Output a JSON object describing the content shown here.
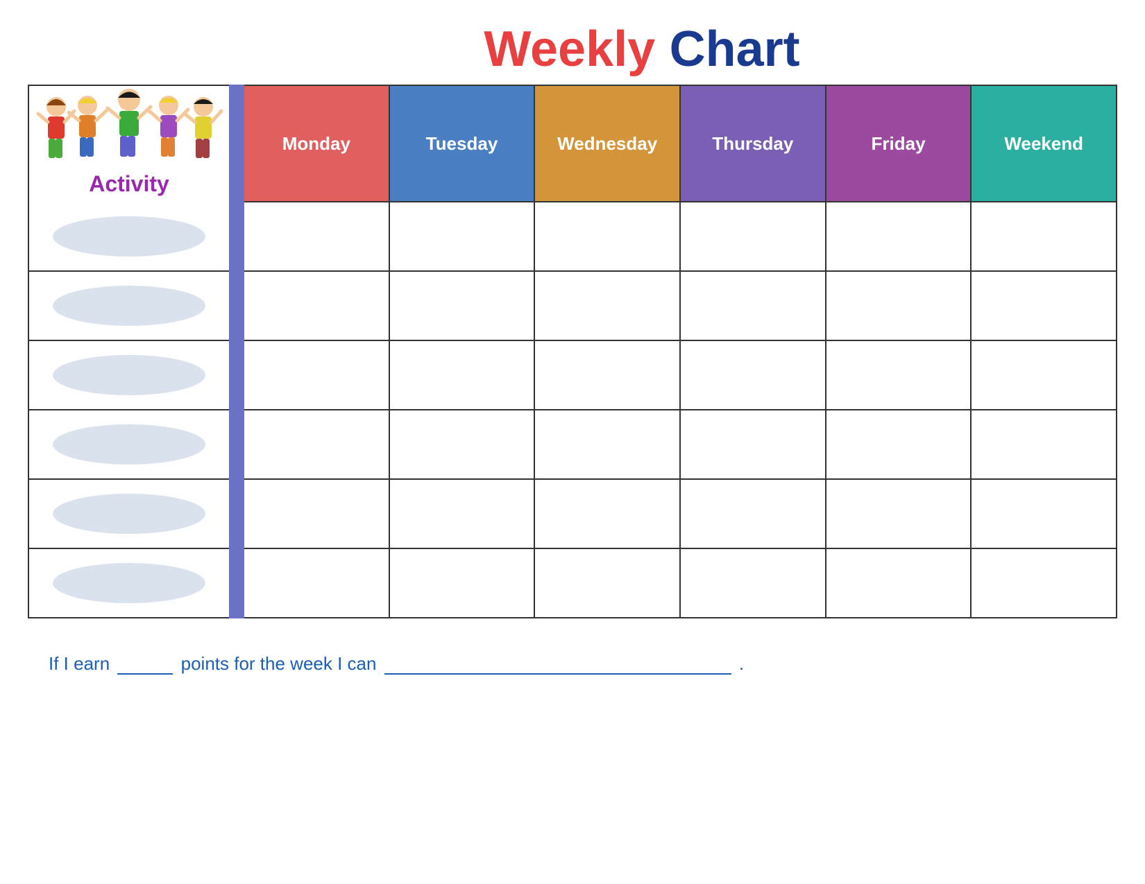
{
  "title": {
    "weekly": "Weekly",
    "chart": "Chart"
  },
  "activity_label": "Activity",
  "days": [
    {
      "id": "monday",
      "label": "Monday",
      "class": "day-monday"
    },
    {
      "id": "tuesday",
      "label": "Tuesday",
      "class": "day-tuesday"
    },
    {
      "id": "wednesday",
      "label": "Wednesday",
      "class": "day-wednesday"
    },
    {
      "id": "thursday",
      "label": "Thursday",
      "class": "day-thursday"
    },
    {
      "id": "friday",
      "label": "Friday",
      "class": "day-friday"
    },
    {
      "id": "weekend",
      "label": "Weekend",
      "class": "day-weekend"
    }
  ],
  "rows": 6,
  "bottom_text": {
    "prefix": "If I earn",
    "middle": "points for the week I can",
    "suffix": "."
  },
  "colors": {
    "title_red": "#e84040",
    "title_blue": "#1a3a8f",
    "activity_purple": "#9b27af",
    "divider_blue": "#6b72c4",
    "monday": "#e06060",
    "tuesday": "#4a7fc4",
    "wednesday": "#d4943a",
    "thursday": "#7a5fb5",
    "friday": "#9c4aa0",
    "weekend": "#2aafa0"
  }
}
